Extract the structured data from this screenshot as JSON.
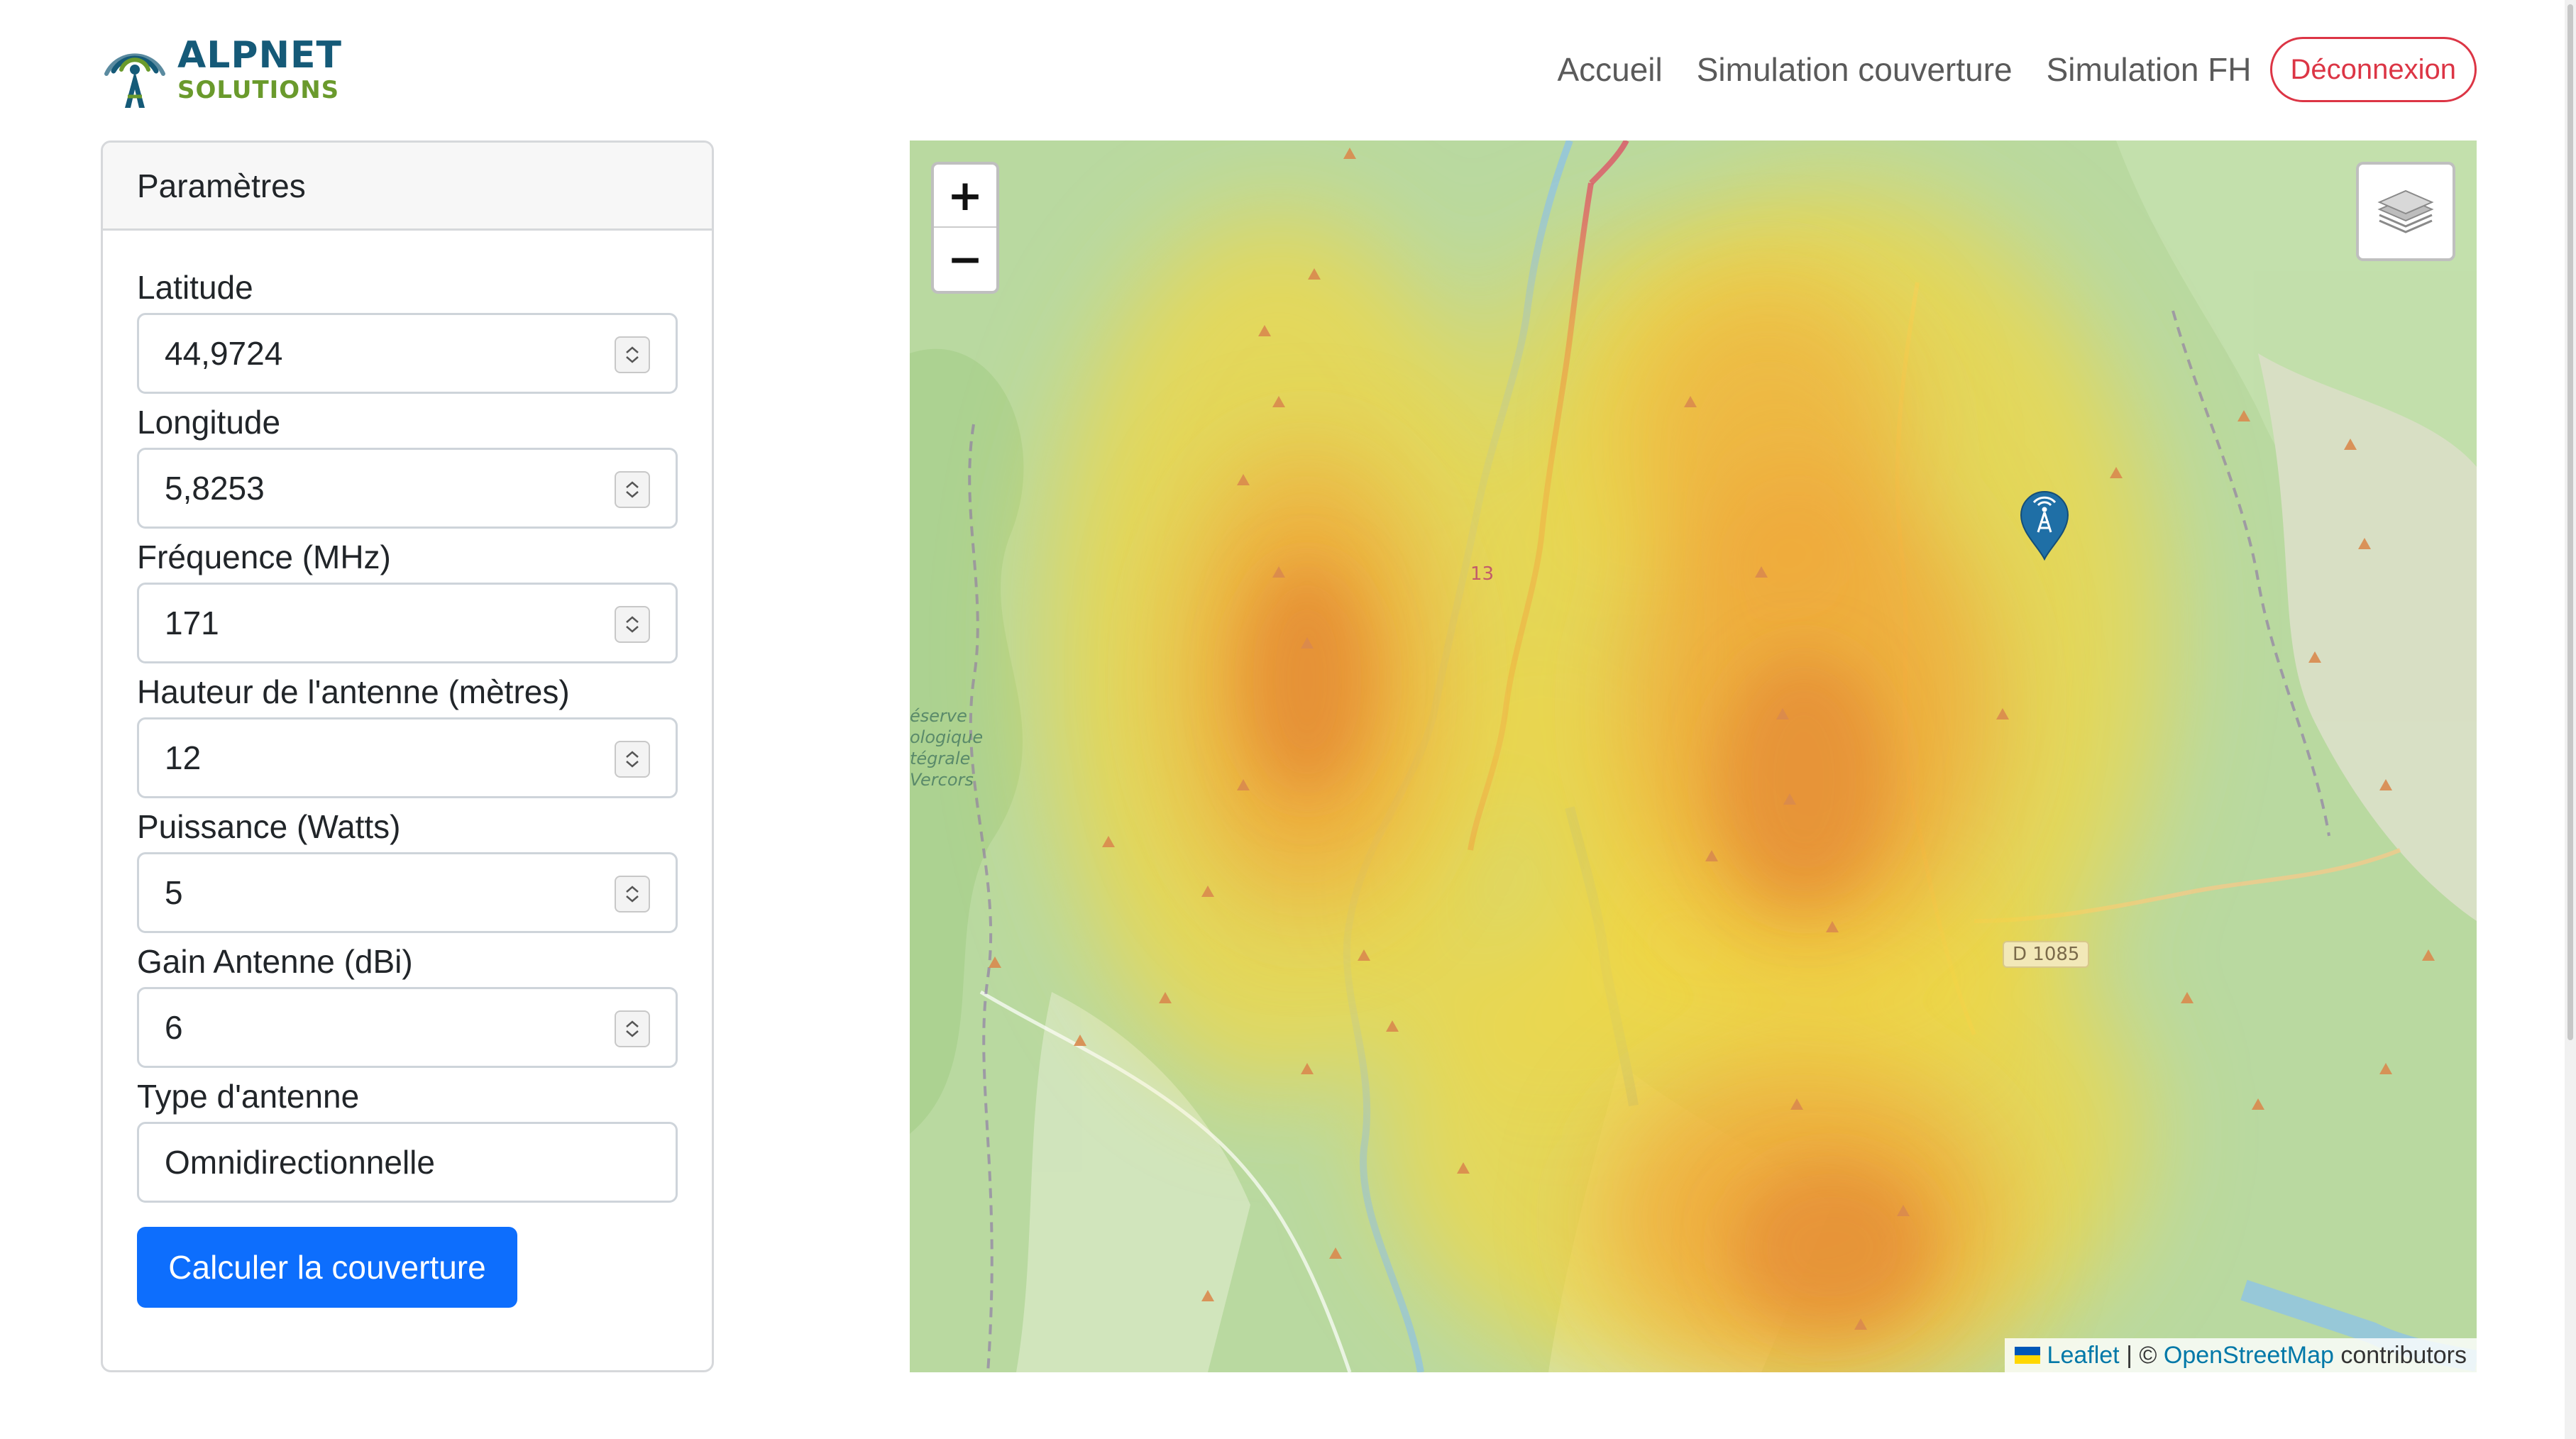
{
  "brand": {
    "name_line1": "ALPNET",
    "name_line2": "SOLUTIONS",
    "color_primary": "#155a78",
    "color_secondary": "#6a9a2c"
  },
  "nav": {
    "items": [
      {
        "label": "Accueil"
      },
      {
        "label": "Simulation couverture"
      },
      {
        "label": "Simulation FH"
      }
    ],
    "logout_label": "Déconnexion"
  },
  "params": {
    "title": "Paramètres",
    "fields": [
      {
        "label": "Latitude",
        "value": "44,9724",
        "type": "number"
      },
      {
        "label": "Longitude",
        "value": "5,8253",
        "type": "number"
      },
      {
        "label": "Fréquence (MHz)",
        "value": "171",
        "type": "number"
      },
      {
        "label": "Hauteur de l'antenne (mètres)",
        "value": "12",
        "type": "number"
      },
      {
        "label": "Puissance (Watts)",
        "value": "5",
        "type": "number"
      },
      {
        "label": "Gain Antenne (dBi)",
        "value": "6",
        "type": "number"
      },
      {
        "label": "Type d'antenne",
        "value": "Omnidirectionnelle",
        "type": "select"
      }
    ],
    "submit_label": "Calculer la couverture",
    "accent_color": "#0d6efd"
  },
  "map": {
    "zoom_in": "+",
    "zoom_out": "−",
    "layers_icon": "layers-icon",
    "marker_icon": "antenna-tower-icon",
    "attribution": {
      "leaflet": "Leaflet",
      "separator": " | © ",
      "osm": "OpenStreetMap",
      "suffix": " contributors"
    },
    "labels": {
      "reserve": [
        "éserve",
        "ologique",
        "tégrale",
        "Vercors"
      ],
      "road_n": "13",
      "road_d": "D 1085"
    }
  }
}
